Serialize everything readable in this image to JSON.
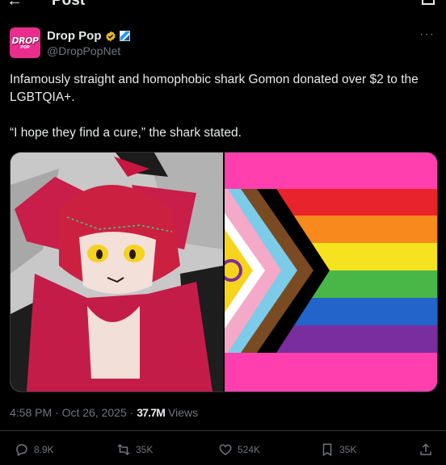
{
  "topbar": {
    "title": "Post",
    "back_label": "←"
  },
  "post": {
    "author": {
      "display_name": "Drop Pop",
      "handle": "@DropPopNet",
      "avatar_text": "DROP",
      "avatar_subtext": "POP"
    },
    "more_label": "···",
    "text_lines": [
      "Infamously straight and homophobic shark Gomon donated over $2 to the LGBTQIA+.",
      "“I hope they find a cure,” the shark stated."
    ],
    "timestamp": "4:58 PM · Oct 26, 2025 · ",
    "views_count": "37.7M",
    "views_label": " Views"
  },
  "actions": {
    "replies": "8.9K",
    "reposts": "35K",
    "likes": "524K",
    "bookmarks": "35K"
  },
  "colors": {
    "brand_pink": "#ea2d8c",
    "verified_gold": "#e8b829",
    "muted": "#71767b"
  }
}
